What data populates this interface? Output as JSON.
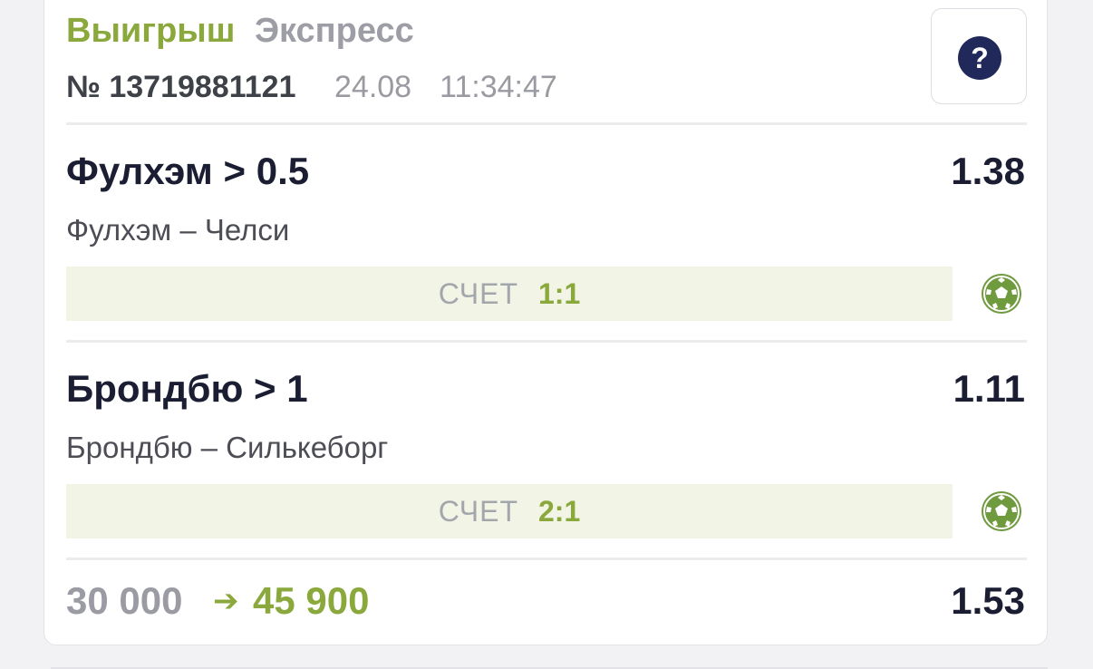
{
  "header": {
    "status": "Выигрыш",
    "bet_type": "Экспресс",
    "ticket_number": "№ 13719881121",
    "date": "24.08",
    "time": "11:34:47",
    "help_symbol": "?"
  },
  "picks": [
    {
      "selection": "Фулхэм > 0.5",
      "odds": "1.38",
      "match": "Фулхэм – Челси",
      "score_label": "СЧЕТ",
      "score": "1:1",
      "sport_icon": "soccer-ball-icon"
    },
    {
      "selection": "Брондбю > 1",
      "odds": "1.11",
      "match": "Брондбю – Силькеборг",
      "score_label": "СЧЕТ",
      "score": "2:1",
      "sport_icon": "soccer-ball-icon"
    }
  ],
  "summary": {
    "stake": "30 000",
    "arrow": "➔",
    "payout": "45 900",
    "total_odds": "1.53"
  },
  "colors": {
    "win_green": "#8aa83c",
    "navy": "#1b1d33",
    "score_bg": "#f2f4e6"
  }
}
